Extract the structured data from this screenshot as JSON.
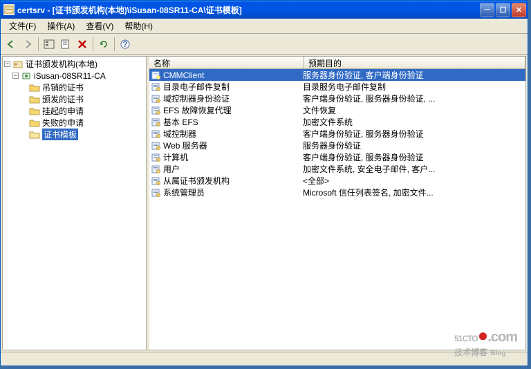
{
  "title": "certsrv - [证书颁发机构(本地)\\iSusan-08SR11-CA\\证书模板]",
  "menus": [
    {
      "label": "文件(F)"
    },
    {
      "label": "操作(A)"
    },
    {
      "label": "查看(V)"
    },
    {
      "label": "帮助(H)"
    }
  ],
  "tree": {
    "root": "证书颁发机构(本地)",
    "ca": "iSusan-08SR11-CA",
    "children": [
      "吊销的证书",
      "颁发的证书",
      "挂起的申请",
      "失败的申请",
      "证书模板"
    ],
    "selectedIndex": 4
  },
  "columns": {
    "name": "名称",
    "purpose": "预期目的"
  },
  "rows": [
    {
      "name": "CMMClient",
      "purpose": "服务器身份验证, 客户端身份验证",
      "selected": true
    },
    {
      "name": "目录电子邮件复制",
      "purpose": "目录服务电子邮件复制"
    },
    {
      "name": "域控制器身份验证",
      "purpose": "客户端身份验证, 服务器身份验证, ..."
    },
    {
      "name": "EFS 故障恢复代理",
      "purpose": "文件恢复"
    },
    {
      "name": "基本 EFS",
      "purpose": "加密文件系统"
    },
    {
      "name": "域控制器",
      "purpose": "客户端身份验证, 服务器身份验证"
    },
    {
      "name": "Web 服务器",
      "purpose": "服务器身份验证"
    },
    {
      "name": "计算机",
      "purpose": "客户端身份验证, 服务器身份验证"
    },
    {
      "name": "用户",
      "purpose": "加密文件系统, 安全电子邮件, 客户..."
    },
    {
      "name": "从属证书颁发机构",
      "purpose": "<全部>"
    },
    {
      "name": "系统管理员",
      "purpose": "Microsoft 信任列表签名, 加密文件..."
    }
  ],
  "watermark": {
    "top": "51CTO",
    "dot": ".com",
    "bot": "技术博客",
    "blog": "Blog"
  }
}
